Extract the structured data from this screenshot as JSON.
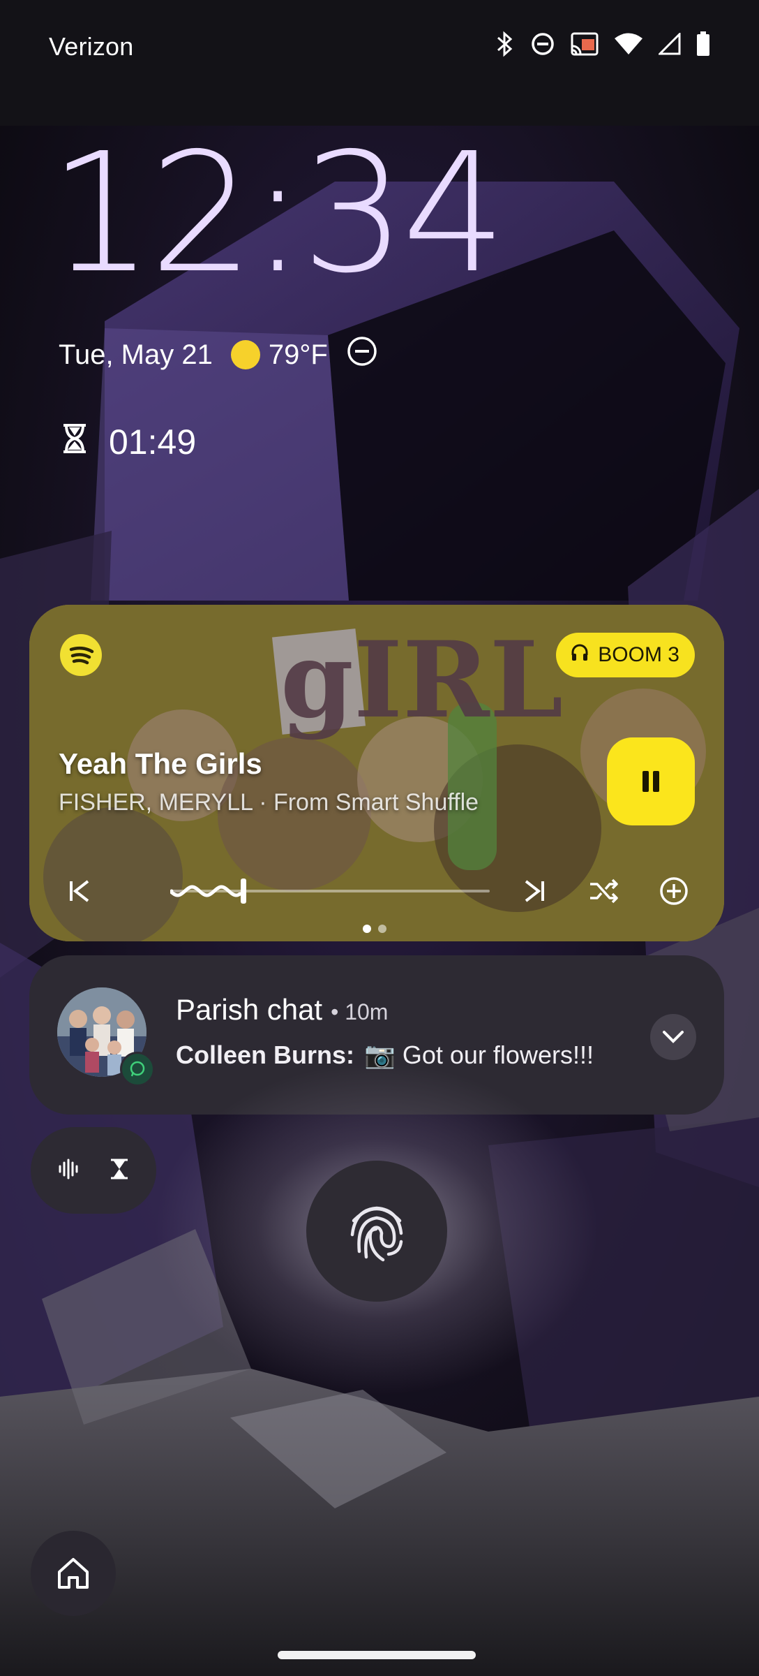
{
  "status_bar": {
    "carrier": "Verizon",
    "icons": [
      "bluetooth-icon",
      "do-not-disturb-icon",
      "cast-icon",
      "wifi-icon",
      "cell-signal-icon",
      "battery-icon"
    ]
  },
  "lockscreen": {
    "clock": "12:34",
    "date": "Tue, May 21",
    "weather_temp": "79°F",
    "weather_icon": "sun-icon",
    "dnd_icon": "do-not-disturb-icon",
    "timer_icon": "hourglass-icon",
    "timer": "01:49"
  },
  "media": {
    "app_icon": "spotify-icon",
    "output_device": "BOOM 3",
    "output_icon": "headphones-icon",
    "title": "Yeah The Girls",
    "subtitle": "FISHER, MERYLL · From Smart Shuffle",
    "album_art_text": "gIRL",
    "progress": 0.22,
    "controls": [
      "previous-icon",
      "next-icon",
      "shuffle-icon",
      "add-icon"
    ],
    "play_state": "playing",
    "page_count": 2,
    "active_page": 1,
    "accent_color": "#fbe51c"
  },
  "notification": {
    "title": "Parish chat",
    "time": "10m",
    "sender": "Colleen Burns:",
    "message": "📷 Got our flowers!!!",
    "app_badge": "whatsapp-icon",
    "expand_icon": "chevron-down-icon"
  },
  "shortcuts": {
    "icons": [
      "sound-wave-icon",
      "hourglass-icon"
    ]
  },
  "unlock": {
    "fingerprint_icon": "fingerprint-icon",
    "home_icon": "home-icon"
  }
}
